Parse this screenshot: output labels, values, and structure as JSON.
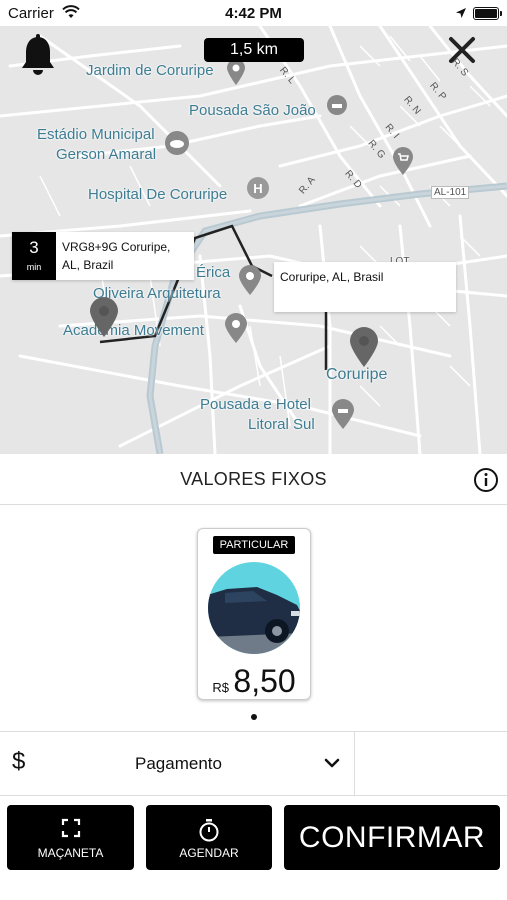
{
  "status_bar": {
    "carrier": "Carrier",
    "time": "4:42 PM"
  },
  "map": {
    "distance": "1,5 km",
    "labels": {
      "jardim": "Jardim de Coruripe",
      "pousada_sao_joao": "Pousada São João",
      "estadio_1": "Estádio Municipal",
      "estadio_2": "Gerson Amaral",
      "hospital": "Hospital De Coruripe",
      "erica": "Érica",
      "oliveira": "Oliveira Arquitetura",
      "academia": "Academia Movement",
      "coruripe": "Coruripe",
      "pousada_hotel_1": "Pousada e Hotel",
      "pousada_hotel_2": "Litoral Sul",
      "al101": "AL-101",
      "lot": "LOT"
    },
    "streets": [
      "R. S",
      "R. P",
      "R. N",
      "R. I",
      "R. G",
      "R. A",
      "R. D",
      "R. L"
    ],
    "pickup": {
      "eta_value": "3",
      "eta_unit": "min",
      "address": "VRG8+9G Coruripe, AL, Brazil"
    },
    "destination": {
      "address": "Coruripe, AL, Brasil"
    }
  },
  "pricing": {
    "title": "VALORES FIXOS",
    "card": {
      "tag": "PARTICULAR",
      "currency": "R$",
      "value": "8,50"
    }
  },
  "payment": {
    "symbol": "$",
    "label": "Pagamento"
  },
  "actions": {
    "door": "MAÇANETA",
    "schedule": "AGENDAR",
    "confirm": "CONFIRMAR"
  },
  "colors": {
    "accent": "#000000",
    "map_bg": "#e6e6e6",
    "map_label": "#3d7c92",
    "river": "#b9c9d2"
  }
}
